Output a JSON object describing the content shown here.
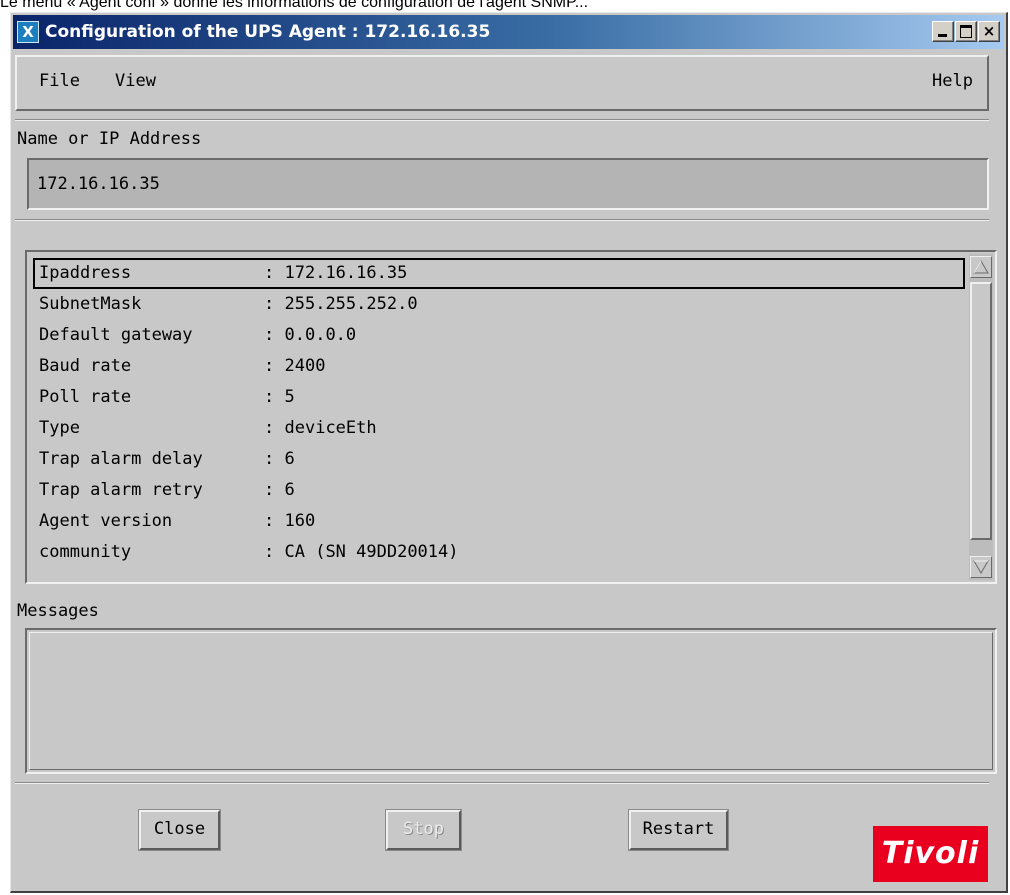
{
  "caption": "Le menu « Agent conf » donne les informations de configuration de l'agent SNMP...",
  "window": {
    "title": "Configuration of the UPS Agent : 172.16.16.35",
    "title_icon": "X",
    "close_glyph": "×"
  },
  "menubar": {
    "items": [
      {
        "label": "File"
      },
      {
        "label": "View"
      },
      {
        "label": "Help"
      }
    ]
  },
  "address": {
    "label": "Name or IP Address",
    "value": "172.16.16.35"
  },
  "config": {
    "rows": [
      {
        "key": "Ipaddress",
        "sep": ":",
        "value": "172.16.16.35"
      },
      {
        "key": "SubnetMask",
        "sep": ":",
        "value": "255.255.252.0"
      },
      {
        "key": "Default gateway",
        "sep": ":",
        "value": "0.0.0.0"
      },
      {
        "key": "Baud rate",
        "sep": ":",
        "value": "2400"
      },
      {
        "key": "Poll rate",
        "sep": ":",
        "value": "5"
      },
      {
        "key": "Type",
        "sep": ":",
        "value": "deviceEth"
      },
      {
        "key": "Trap alarm delay",
        "sep": ":",
        "value": "6"
      },
      {
        "key": "Trap alarm retry",
        "sep": ":",
        "value": "6"
      },
      {
        "key": "Agent version",
        "sep": ":",
        "value": "160"
      },
      {
        "key": "community",
        "sep": ":",
        "value": "CA (SN 49DD20014)"
      }
    ],
    "selected_row": 0
  },
  "messages": {
    "label": "Messages",
    "text": ""
  },
  "buttons": {
    "close": "Close",
    "stop": "Stop",
    "restart": "Restart"
  },
  "logo": {
    "text": "Tivoli",
    "color": "#e8001e"
  }
}
